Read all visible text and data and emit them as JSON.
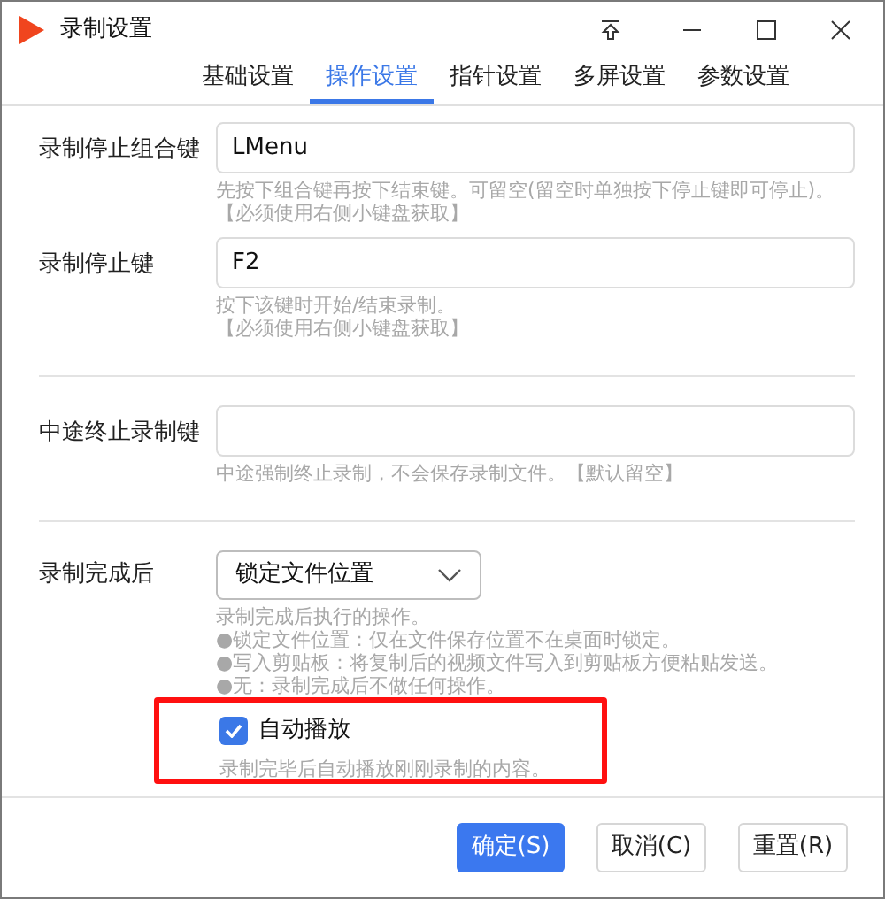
{
  "window": {
    "title": "录制设置"
  },
  "tabs": [
    {
      "label": "基础设置",
      "selected": false
    },
    {
      "label": "操作设置",
      "selected": true
    },
    {
      "label": "指针设置",
      "selected": false
    },
    {
      "label": "多屏设置",
      "selected": false
    },
    {
      "label": "参数设置",
      "selected": false
    }
  ],
  "sections": [
    {
      "rows": [
        {
          "label": "录制停止组合键",
          "value": "LMenu",
          "hints": [
            "先按下组合键再按下结束键。可留空(留空时单独按下停止键即可停止)。",
            "【必须使用右侧小键盘获取】"
          ]
        },
        {
          "label": "录制停止键",
          "value": "F2",
          "hints": [
            "按下该键时开始/结束录制。",
            "【必须使用右侧小键盘获取】"
          ]
        }
      ]
    },
    {
      "rows": [
        {
          "label": "中途终止录制键",
          "value": "",
          "hints": [
            "中途强制终止录制，不会保存录制文件。【默认留空】"
          ]
        }
      ]
    }
  ],
  "after_record": {
    "label": "录制完成后",
    "dropdown": "锁定文件位置",
    "hints": [
      "录制完成后执行的操作。",
      "●锁定文件位置：仅在文件保存位置不在桌面时锁定。",
      "●写入剪贴板：将复制后的视频文件写入到剪贴板方便粘贴发送。",
      "●无：录制完成后不做任何操作。"
    ],
    "autoplay": {
      "label": "自动播放",
      "checked": true,
      "highlighted": true,
      "hint": "录制完毕后自动播放刚刚录制的内容。"
    }
  },
  "buttons": [
    {
      "label": "确定(S)",
      "kind": "primary"
    },
    {
      "label": "取消(C)",
      "kind": "normal"
    },
    {
      "label": "重置(R)",
      "kind": "normal"
    }
  ]
}
